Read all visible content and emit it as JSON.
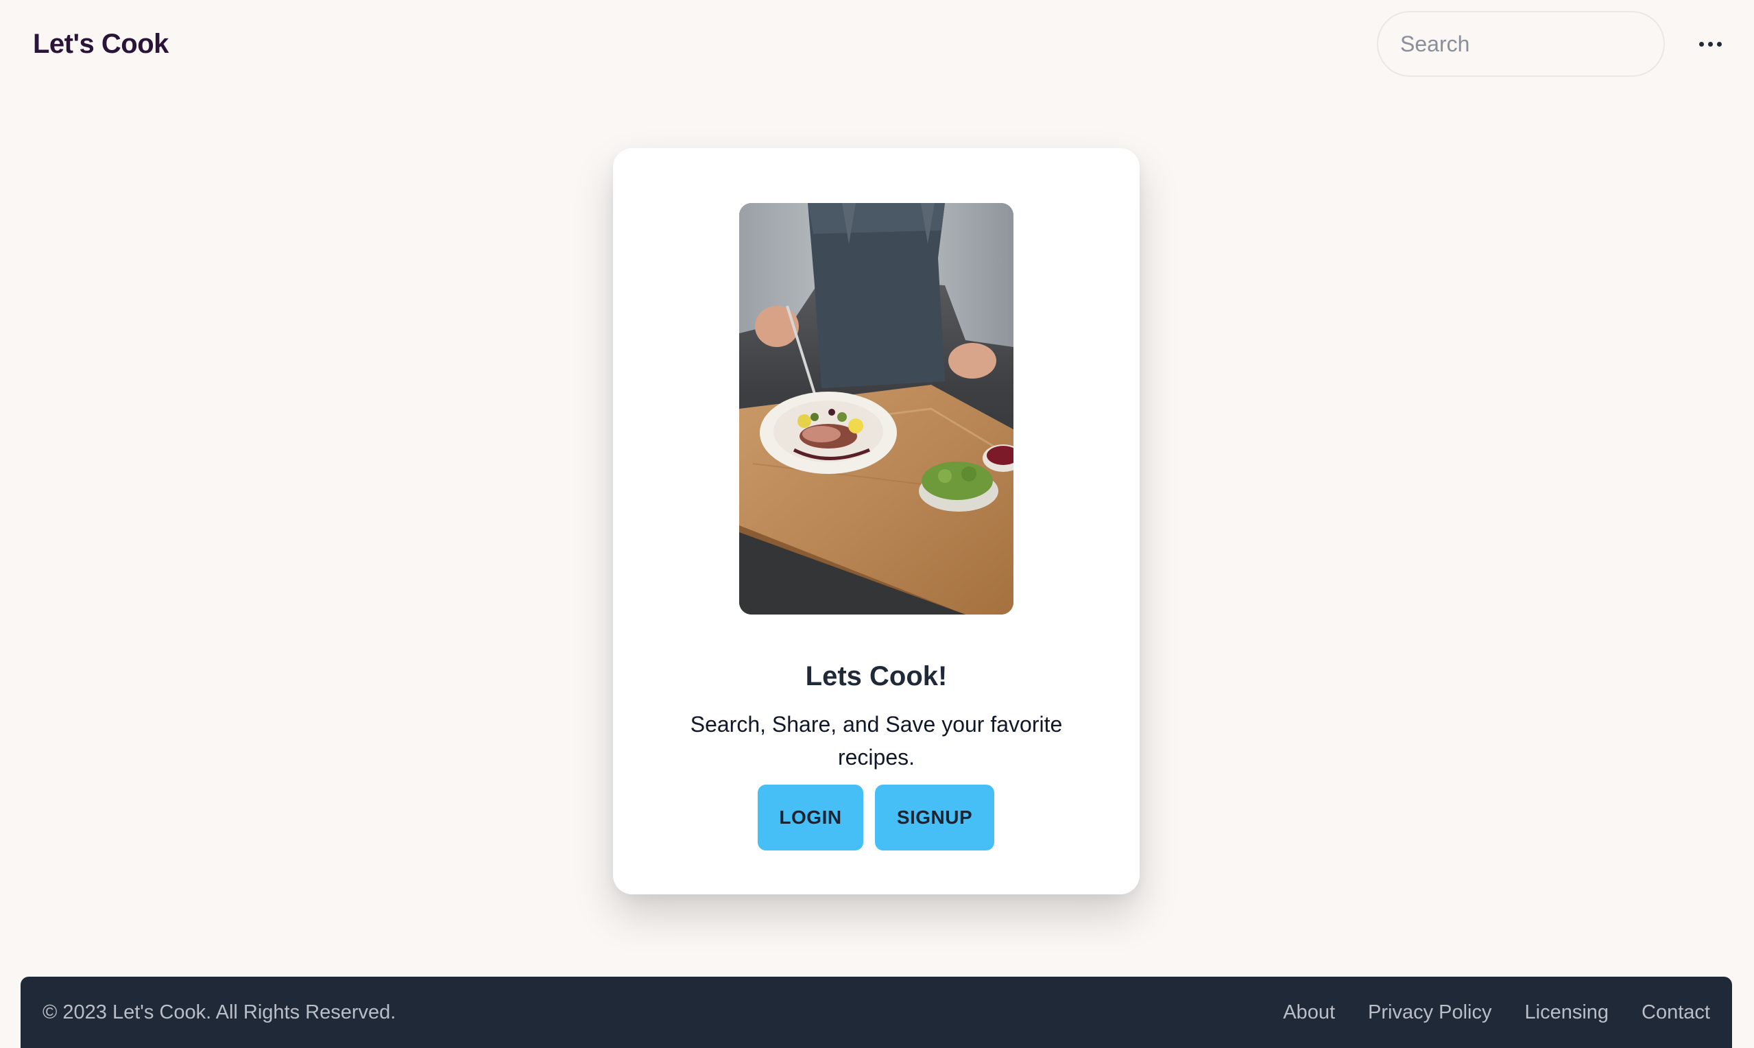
{
  "header": {
    "brand": "Let's Cook",
    "search": {
      "placeholder": "Search",
      "value": ""
    },
    "more_icon": "ellipsis-horizontal-icon"
  },
  "card": {
    "image": "chef-plating-dish-photo",
    "title": "Lets Cook!",
    "description": "Search, Share, and Save your favorite recipes.",
    "buttons": {
      "login": "LOGIN",
      "signup": "SIGNUP"
    }
  },
  "footer": {
    "copyright": "© 2023 Let's Cook. All Rights Reserved.",
    "links": [
      "About",
      "Privacy Policy",
      "Licensing",
      "Contact"
    ]
  },
  "colors": {
    "background": "#faf7f4",
    "brand_text": "#2a1538",
    "button": "#45bff5",
    "footer_bg": "#1f2937",
    "footer_text": "#b9bec8"
  }
}
